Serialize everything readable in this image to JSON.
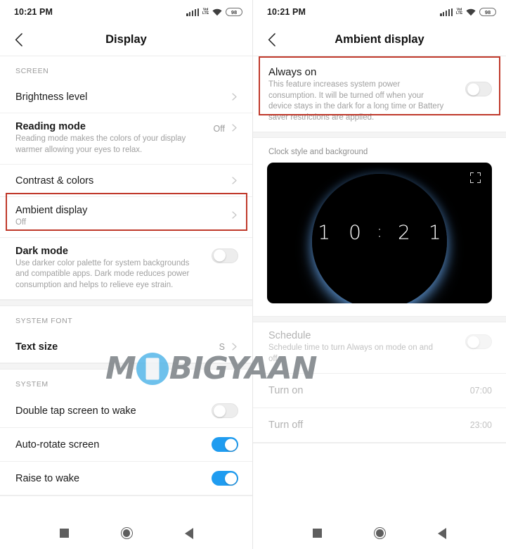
{
  "status_bar": {
    "time": "10:21 PM",
    "battery": "98",
    "volte_top": "VoI",
    "volte_bottom": "LTE"
  },
  "left_screen": {
    "title": "Display",
    "sections": [
      {
        "header": "SCREEN",
        "rows": [
          {
            "title": "Brightness level",
            "sub": "",
            "value": "",
            "control": "chevron",
            "name": "row-brightness-level"
          },
          {
            "title": "Reading mode",
            "sub": "Reading mode makes the colors of your display warmer allowing your eyes to relax.",
            "value": "Off",
            "control": "chevron",
            "name": "row-reading-mode"
          },
          {
            "title": "Contrast & colors",
            "sub": "",
            "value": "",
            "control": "chevron",
            "name": "row-contrast-colors"
          },
          {
            "title": "Ambient display",
            "sub": "Off",
            "value": "",
            "control": "chevron",
            "name": "row-ambient-display",
            "highlighted": true
          },
          {
            "title": "Dark mode",
            "sub": "Use darker color palette for system backgrounds and compatible apps. Dark mode reduces power consumption and helps to relieve eye strain.",
            "value": "",
            "control": "toggle-off",
            "name": "row-dark-mode"
          }
        ]
      },
      {
        "header": "SYSTEM FONT",
        "rows": [
          {
            "title": "Text size",
            "sub": "",
            "value": "S",
            "control": "chevron",
            "name": "row-text-size"
          }
        ]
      },
      {
        "header": "SYSTEM",
        "rows": [
          {
            "title": "Double tap screen to wake",
            "sub": "",
            "value": "",
            "control": "toggle-off",
            "name": "row-double-tap-to-wake"
          },
          {
            "title": "Auto-rotate screen",
            "sub": "",
            "value": "",
            "control": "toggle-on",
            "name": "row-auto-rotate-screen"
          },
          {
            "title": "Raise to wake",
            "sub": "",
            "value": "",
            "control": "toggle-on",
            "name": "row-raise-to-wake"
          }
        ]
      }
    ]
  },
  "right_screen": {
    "title": "Ambient display",
    "always_on": {
      "title": "Always on",
      "sub": "This feature increases system power consumption. It will be turned off when your device stays in the dark for a long time or Battery saver restrictions are applied.",
      "toggle": "off"
    },
    "clock_preview": {
      "label": "Clock style and background",
      "digits": [
        "1",
        "0",
        ":",
        "2",
        "1"
      ]
    },
    "schedule": {
      "title": "Schedule",
      "sub": "Schedule time to turn Always on mode on and off",
      "toggle": "off",
      "rows": [
        {
          "title": "Turn on",
          "value": "07:00"
        },
        {
          "title": "Turn off",
          "value": "23:00"
        }
      ]
    }
  },
  "watermark": {
    "part1": "M",
    "part2": "BIGYAAN"
  },
  "colors": {
    "accent_blue": "#1f9cf0",
    "annotation_red": "#c0392b",
    "text_primary": "#1a1a1a",
    "text_secondary": "#a0a0a0"
  }
}
